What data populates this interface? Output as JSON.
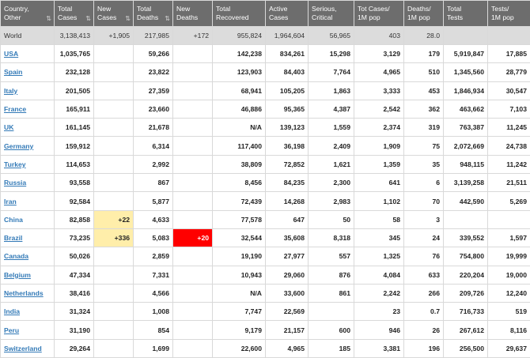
{
  "headers": [
    {
      "label": "Country,\nOther",
      "sortable": true
    },
    {
      "label": "Total\nCases",
      "sortable": true
    },
    {
      "label": "New\nCases",
      "sortable": true
    },
    {
      "label": "Total\nDeaths",
      "sortable": true
    },
    {
      "label": "New\nDeaths",
      "sortable": false
    },
    {
      "label": "Total\nRecovered",
      "sortable": false
    },
    {
      "label": "Active\nCases",
      "sortable": false
    },
    {
      "label": "Serious,\nCritical",
      "sortable": false
    },
    {
      "label": "Tot Cases/\n1M pop",
      "sortable": false
    },
    {
      "label": "Deaths/\n1M pop",
      "sortable": false
    },
    {
      "label": "Total\nTests",
      "sortable": false
    },
    {
      "label": "Tests/\n1M pop",
      "sortable": false
    }
  ],
  "world": [
    "World",
    "3,138,413",
    "+1,905",
    "217,985",
    "+172",
    "955,824",
    "1,964,604",
    "56,965",
    "403",
    "28.0",
    "",
    ""
  ],
  "rows": [
    {
      "country": "USA",
      "link": true,
      "cells": [
        "1,035,765",
        "",
        "59,266",
        "",
        "142,238",
        "834,261",
        "15,298",
        "3,129",
        "179",
        "5,919,847",
        "17,885"
      ]
    },
    {
      "country": "Spain",
      "link": true,
      "cells": [
        "232,128",
        "",
        "23,822",
        "",
        "123,903",
        "84,403",
        "7,764",
        "4,965",
        "510",
        "1,345,560",
        "28,779"
      ]
    },
    {
      "country": "Italy",
      "link": true,
      "cells": [
        "201,505",
        "",
        "27,359",
        "",
        "68,941",
        "105,205",
        "1,863",
        "3,333",
        "453",
        "1,846,934",
        "30,547"
      ]
    },
    {
      "country": "France",
      "link": true,
      "cells": [
        "165,911",
        "",
        "23,660",
        "",
        "46,886",
        "95,365",
        "4,387",
        "2,542",
        "362",
        "463,662",
        "7,103"
      ]
    },
    {
      "country": "UK",
      "link": true,
      "cells": [
        "161,145",
        "",
        "21,678",
        "",
        "N/A",
        "139,123",
        "1,559",
        "2,374",
        "319",
        "763,387",
        "11,245"
      ]
    },
    {
      "country": "Germany",
      "link": true,
      "cells": [
        "159,912",
        "",
        "6,314",
        "",
        "117,400",
        "36,198",
        "2,409",
        "1,909",
        "75",
        "2,072,669",
        "24,738"
      ]
    },
    {
      "country": "Turkey",
      "link": true,
      "cells": [
        "114,653",
        "",
        "2,992",
        "",
        "38,809",
        "72,852",
        "1,621",
        "1,359",
        "35",
        "948,115",
        "11,242"
      ]
    },
    {
      "country": "Russia",
      "link": true,
      "cells": [
        "93,558",
        "",
        "867",
        "",
        "8,456",
        "84,235",
        "2,300",
        "641",
        "6",
        "3,139,258",
        "21,511"
      ]
    },
    {
      "country": "Iran",
      "link": true,
      "cells": [
        "92,584",
        "",
        "5,877",
        "",
        "72,439",
        "14,268",
        "2,983",
        "1,102",
        "70",
        "442,590",
        "5,269"
      ]
    },
    {
      "country": "China",
      "link": false,
      "cells": [
        "82,858",
        "+22",
        "4,633",
        "",
        "77,578",
        "647",
        "50",
        "58",
        "3",
        "",
        ""
      ]
    },
    {
      "country": "Brazil",
      "link": true,
      "cells": [
        "73,235",
        "+336",
        "5,083",
        "+20",
        "32,544",
        "35,608",
        "8,318",
        "345",
        "24",
        "339,552",
        "1,597"
      ]
    },
    {
      "country": "Canada",
      "link": true,
      "cells": [
        "50,026",
        "",
        "2,859",
        "",
        "19,190",
        "27,977",
        "557",
        "1,325",
        "76",
        "754,800",
        "19,999"
      ]
    },
    {
      "country": "Belgium",
      "link": true,
      "cells": [
        "47,334",
        "",
        "7,331",
        "",
        "10,943",
        "29,060",
        "876",
        "4,084",
        "633",
        "220,204",
        "19,000"
      ]
    },
    {
      "country": "Netherlands",
      "link": true,
      "cells": [
        "38,416",
        "",
        "4,566",
        "",
        "N/A",
        "33,600",
        "861",
        "2,242",
        "266",
        "209,726",
        "12,240"
      ]
    },
    {
      "country": "India",
      "link": true,
      "cells": [
        "31,324",
        "",
        "1,008",
        "",
        "7,747",
        "22,569",
        "",
        "23",
        "0.7",
        "716,733",
        "519"
      ]
    },
    {
      "country": "Peru",
      "link": true,
      "cells": [
        "31,190",
        "",
        "854",
        "",
        "9,179",
        "21,157",
        "600",
        "946",
        "26",
        "267,612",
        "8,116"
      ]
    },
    {
      "country": "Switzerland",
      "link": true,
      "cells": [
        "29,264",
        "",
        "1,699",
        "",
        "22,600",
        "4,965",
        "185",
        "3,381",
        "196",
        "256,500",
        "29,637"
      ]
    }
  ],
  "colors": {
    "header_bg": "#6d6d6d",
    "world_row_bg": "#dcdcdc",
    "new_cases_highlight": "#ffeeaa",
    "new_deaths_highlight": "#ff0000",
    "link": "#337ab7"
  },
  "icons": {
    "sort": "sort-arrows-icon"
  }
}
